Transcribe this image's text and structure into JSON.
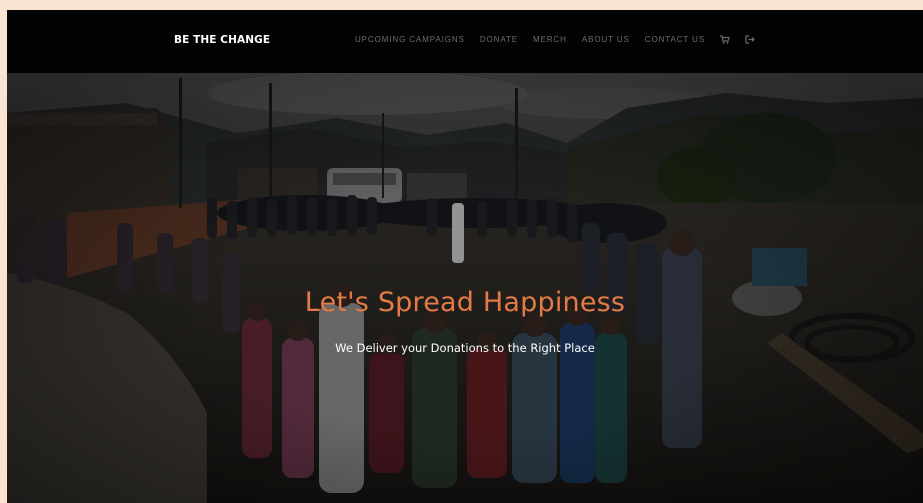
{
  "nav": {
    "brand": "BE THE CHANGE",
    "links": [
      "UPCOMING CAMPAIGNS",
      "DONATE",
      "MERCH",
      "ABOUT US",
      "CONTACT US"
    ],
    "icons": [
      "cart-icon",
      "logout-icon"
    ]
  },
  "hero": {
    "headline": "Let's Spread Happiness",
    "subheadline": "We Deliver your Donations to the Right Place",
    "image": "photo-people-standing-in-circle-village"
  },
  "colors": {
    "page_background": "#fbe3d2",
    "navbar_background": "#030303",
    "nav_link": "#6c6c6c",
    "headline": "#e37b46",
    "subheadline": "#ffffff"
  }
}
